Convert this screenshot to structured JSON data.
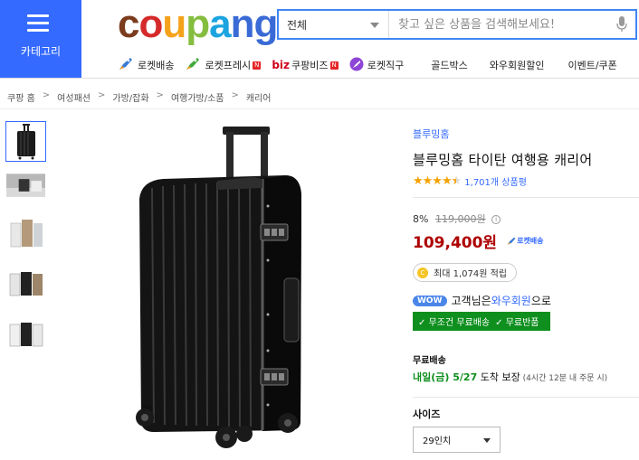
{
  "header": {
    "category_label": "카테고리",
    "logo": [
      "c",
      "o",
      "u",
      "p",
      "a",
      "ng"
    ],
    "search": {
      "category": "전체",
      "placeholder": "찾고 싶은 상품을 검색해보세요!"
    },
    "nav": [
      {
        "label": "로켓배송",
        "icon": "rocket-icon"
      },
      {
        "label": "로켓프레시",
        "icon": "fresh-rocket-icon",
        "badge": "N"
      },
      {
        "label": "쿠팡비즈",
        "prefix": "biz",
        "badge": "N"
      },
      {
        "label": "로켓직구",
        "icon": "global-rocket-icon"
      },
      {
        "label": "골드박스"
      },
      {
        "label": "와우회원할인"
      },
      {
        "label": "이벤트/쿠폰"
      }
    ]
  },
  "breadcrumb": [
    "쿠팡 홈",
    "여성패션",
    "가방/잡화",
    "여행가방/소품",
    "캐리어"
  ],
  "breadcrumb_separator": ">",
  "product": {
    "brand": "블루밍홈",
    "title": "블루밍홈 타이탄 여행용 캐리어",
    "rating": 4.5,
    "review_count": "1,701개 상품평",
    "discount": "8%",
    "original_price": "119,000원",
    "info": "i",
    "sale_price": "109,400원",
    "rocket_label": "로켓배송",
    "reward_coin": "C",
    "reward": "최대 1,074원 적립",
    "wow": {
      "badge": "WOW",
      "pre": "고객님은 ",
      "link": "와우회원",
      "post": "으로"
    },
    "free_shipping": "✓ 무조건 무료배송",
    "free_return": "✓ 무료반품",
    "shipping_label": "무료배송",
    "delivery_date": "내일(금) 5/27",
    "delivery_guarantee": " 도착 보장",
    "delivery_note": " (4시간 12분 내 주문 시)",
    "size_label": "사이즈",
    "size_selected": "29인치"
  },
  "colors": {
    "accent": "#346aff",
    "price": "#ae0000",
    "green": "#0e8f1e"
  }
}
